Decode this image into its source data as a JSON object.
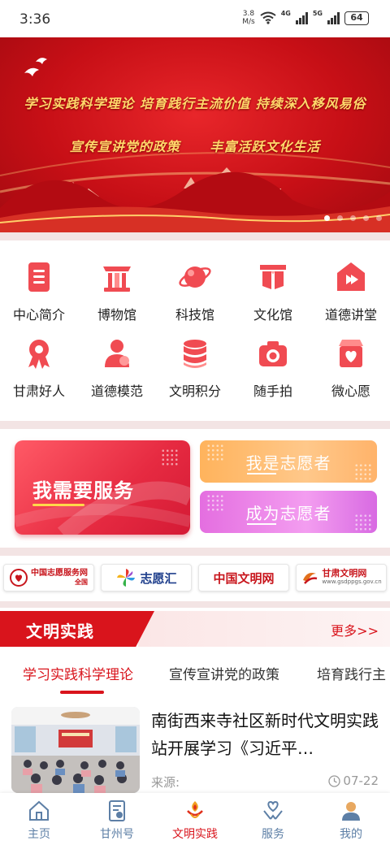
{
  "status_bar": {
    "time": "3:36",
    "speed_value": "3.8",
    "speed_unit": "M/s",
    "net_4g": "4G",
    "net_5g": "5G",
    "battery": "64"
  },
  "banner": {
    "line1": "学习实践科学理论  培育践行主流价值  持续深入移风易俗",
    "line2_a": "宣传宣讲党的政策",
    "line2_b": "丰富活跃文化生活",
    "slide_count": 5,
    "active_slide": 1
  },
  "grid": {
    "items": [
      {
        "label": "中心简介",
        "icon": "document-icon"
      },
      {
        "label": "博物馆",
        "icon": "museum-icon"
      },
      {
        "label": "科技馆",
        "icon": "planet-icon"
      },
      {
        "label": "文化馆",
        "icon": "book-icon"
      },
      {
        "label": "道德讲堂",
        "icon": "lecture-hall-icon"
      },
      {
        "label": "甘肃好人",
        "icon": "award-ribbon-icon"
      },
      {
        "label": "道德模范",
        "icon": "person-icon"
      },
      {
        "label": "文明积分",
        "icon": "coins-stack-icon"
      },
      {
        "label": "随手拍",
        "icon": "camera-icon"
      },
      {
        "label": "微心愿",
        "icon": "heart-card-icon"
      }
    ]
  },
  "volunteer": {
    "need_service": "我需要服务",
    "i_am_volunteer": "我是志愿者",
    "become_volunteer": "成为志愿者"
  },
  "links": {
    "items": [
      {
        "name": "中国志愿服务网",
        "sub": "全国",
        "icon": "volunteer-service-logo"
      },
      {
        "name": "志愿汇",
        "icon": "pinwheel-logo"
      },
      {
        "name": "中国文明网",
        "icon": "wenming-logo"
      },
      {
        "name": "甘肃文明网",
        "sub": "www.gsdppgs.gov.cn",
        "icon": "gansu-wenming-logo"
      }
    ]
  },
  "section": {
    "title": "文明实践",
    "more": "更多>>"
  },
  "tabs": {
    "items": [
      "学习实践科学理论",
      "宣传宣讲党的政策",
      "培育践行主"
    ],
    "active": 0
  },
  "article": {
    "title": "南街西来寺社区新时代文明实践站开展学习《习近平…",
    "source_label": "来源:",
    "date": "07-22"
  },
  "nav": {
    "items": [
      {
        "label": "主页",
        "icon": "home-icon"
      },
      {
        "label": "甘州号",
        "icon": "profile-card-icon"
      },
      {
        "label": "文明实践",
        "icon": "torch-icon"
      },
      {
        "label": "服务",
        "icon": "heart-hands-icon"
      },
      {
        "label": "我的",
        "icon": "user-icon"
      }
    ],
    "active": 2
  },
  "colors": {
    "brand_red": "#d9141c",
    "banner_red": "#c70f16",
    "banner_gold": "#ffd86b",
    "nav_blue": "#5d7fa6"
  }
}
